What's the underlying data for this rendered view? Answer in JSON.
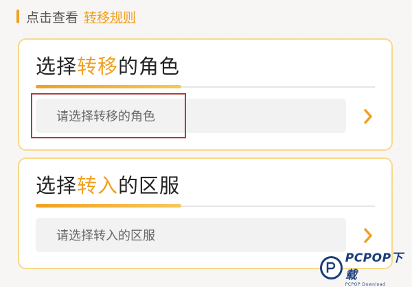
{
  "rules": {
    "prefix": "点击查看",
    "link": "转移规则"
  },
  "card_role": {
    "title_pre": "选择",
    "title_hl": "转移",
    "title_post": "的角色",
    "placeholder": "请选择转移的角色"
  },
  "card_server": {
    "title_pre": "选择",
    "title_hl": "转入",
    "title_post": "的区服",
    "placeholder": "请选择转入的区服"
  },
  "watermark": {
    "main": "PCPOP下载",
    "sub": "PCPOP Download"
  },
  "colors": {
    "accent": "#f0a020",
    "card_border": "#f7d98a",
    "highlight": "#b23a3a"
  },
  "icons": {
    "chevron": "chevron-right-icon"
  }
}
